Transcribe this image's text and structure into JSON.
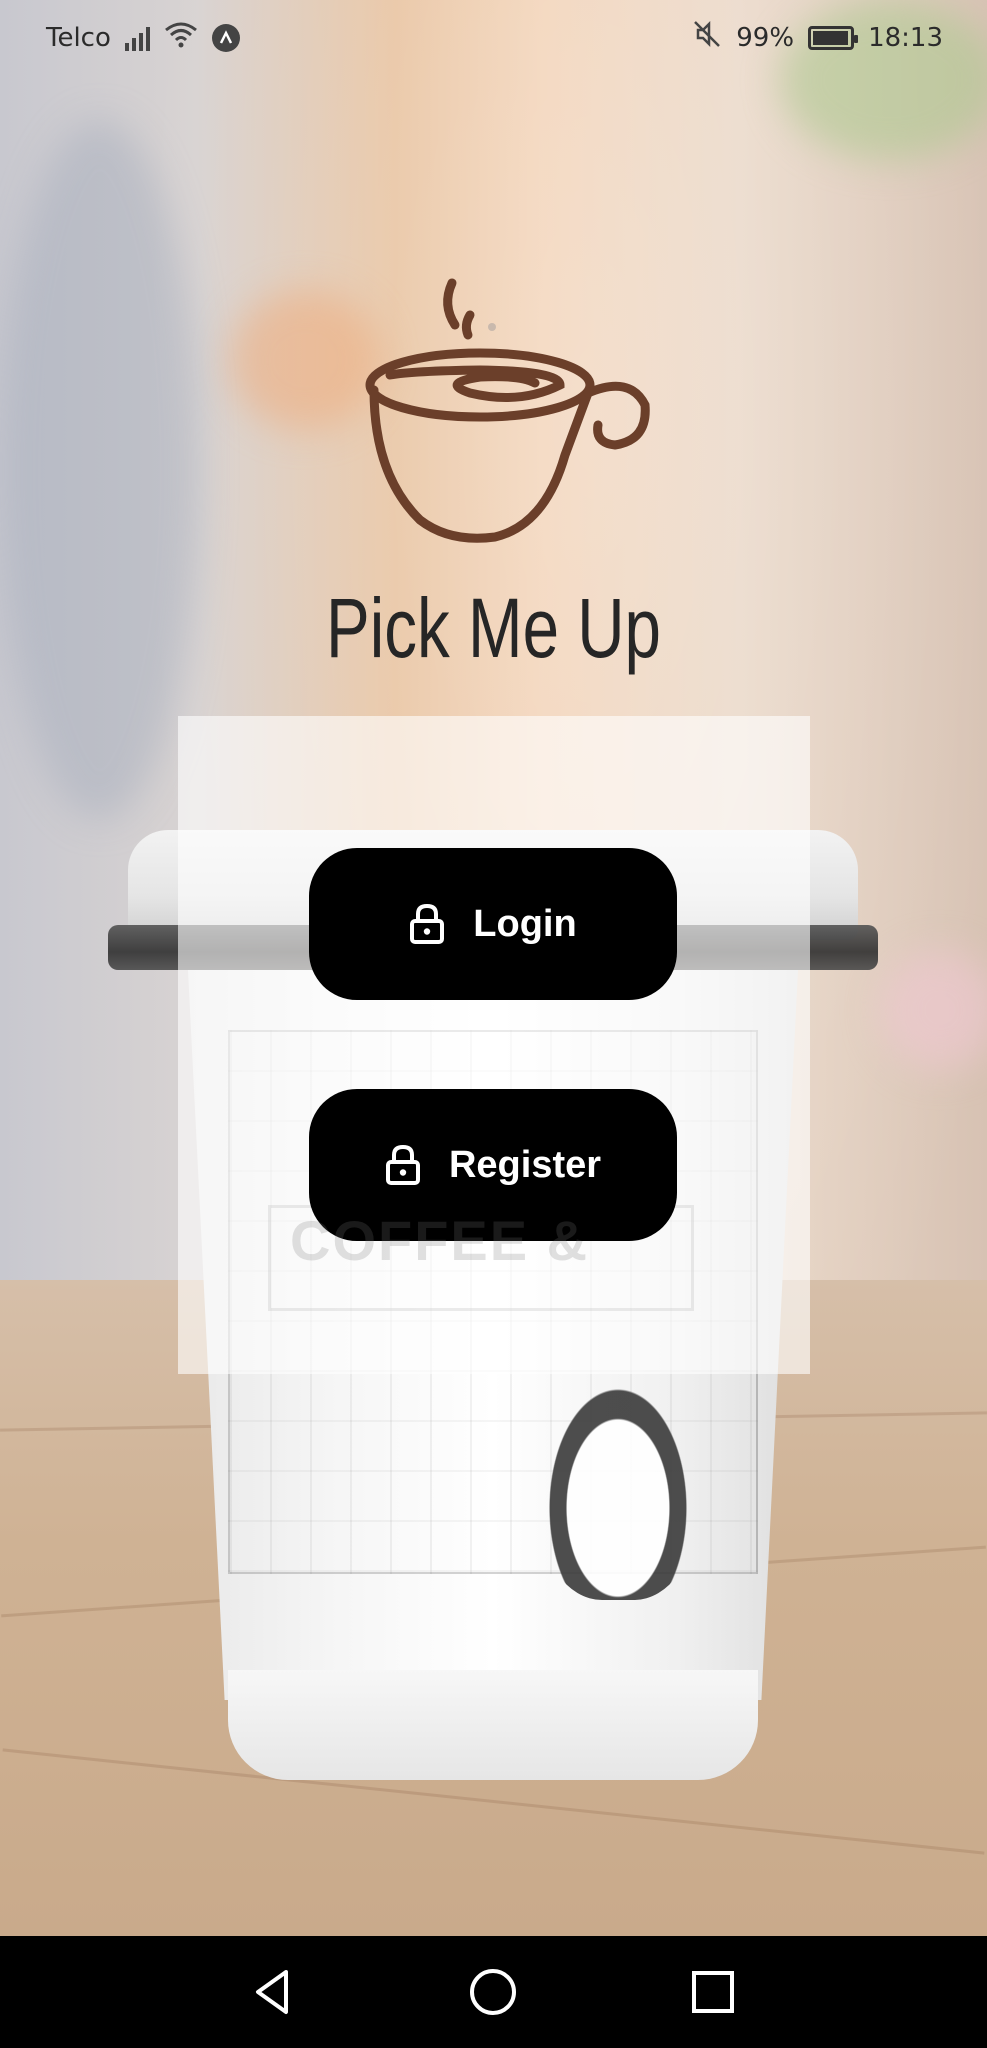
{
  "status_bar": {
    "carrier": "Telco",
    "battery": "99%",
    "time": "18:13",
    "icons": [
      "signal-icon",
      "wifi-icon",
      "anchor-icon",
      "mute-icon",
      "battery-icon"
    ]
  },
  "app": {
    "title": "Pick Me Up",
    "logo_icon": "coffee-cup-icon",
    "logo_color": "#6b3f2a"
  },
  "actions": {
    "login_label": "Login",
    "register_label": "Register",
    "button_icon": "lock-icon",
    "button_color": "#000000"
  },
  "background": {
    "cup_print_text": "COFFEE &"
  },
  "nav_bar": {
    "icons": [
      "back-icon",
      "home-icon",
      "recents-icon"
    ]
  }
}
